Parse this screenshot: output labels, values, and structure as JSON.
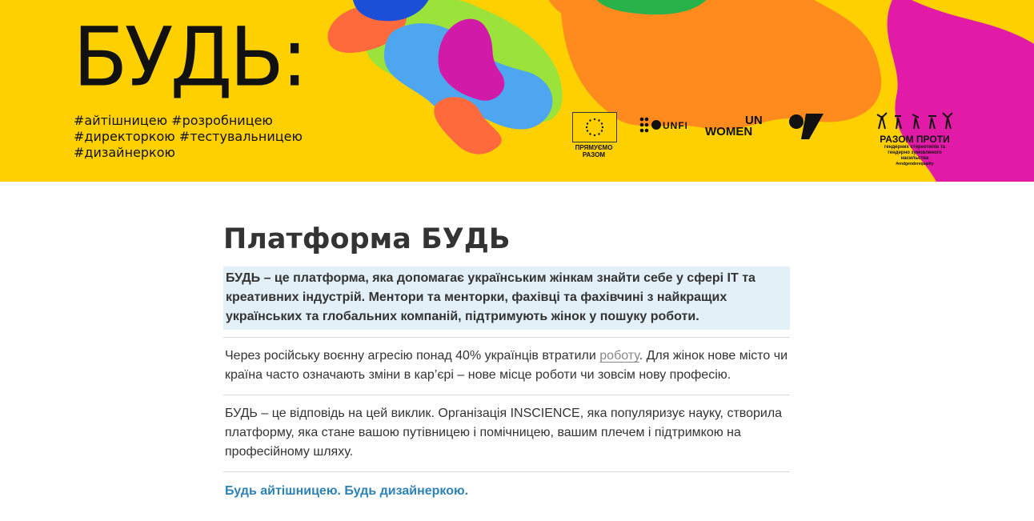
{
  "banner": {
    "brand": "БУДЬ:",
    "hashtags": [
      "#айтішницею #розробницею",
      "#директоркою #тестувальницею",
      "#дизайнеркою"
    ],
    "background_color": "#ffd000",
    "logos": {
      "eu_caption": "ПРЯМУЄМО\nРАЗОМ",
      "undp_unfpa": "UNFPA",
      "un_women_1": "UN",
      "un_women_2": "WOMEN",
      "razom_title": "РАЗОМ ПРОТИ",
      "razom_sub": "гендерних стереотипів та гендерно зумовленого насильства",
      "razom_tag": "#endgenderequality"
    }
  },
  "main": {
    "title": "Платформа БУДЬ",
    "lead": "БУДЬ – це платформа, яка допомагає українським жінкам знайти себе у сфері ІТ та креативних індустрій. Ментори та менторки, фахівці та фахівчині з найкращих українських та глобальних компаній, підтримують жінок у пошуку роботи.",
    "p1_before": "Через російську воєнну агресію понад 40% українців втратили ",
    "p1_link": "роботу",
    "p1_after": ". Для жінок нове місто чи країна часто означають зміни в кар’єрі – нове місце роботи чи зовсім нову професію.",
    "p2": "БУДЬ – це відповідь на цей виклик. Організація INSCIENCE, яка популяризує науку, створила платформу, яка стане вашою путівницею і помічницею, вашим плечем і підтримкою на професійному шляху.",
    "subheading": "Будь айтішницею. Будь дизайнеркою."
  },
  "colors": {
    "accent_link": "#2f82b6",
    "lead_bg": "#e4f0f7"
  }
}
